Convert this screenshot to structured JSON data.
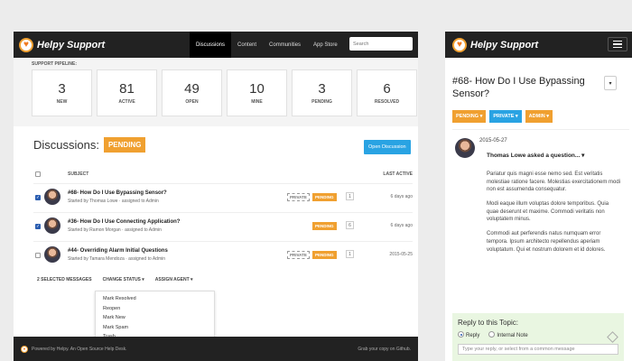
{
  "desktop": {
    "logo": "Helpy Support",
    "nav": [
      "Discussions",
      "Content",
      "Communities",
      "App Store"
    ],
    "search_placeholder": "Search",
    "pipeline_label": "SUPPORT PIPELINE:",
    "pipeline": [
      {
        "num": "3",
        "label": "NEW"
      },
      {
        "num": "81",
        "label": "ACTIVE"
      },
      {
        "num": "49",
        "label": "OPEN"
      },
      {
        "num": "10",
        "label": "MINE"
      },
      {
        "num": "3",
        "label": "PENDING"
      },
      {
        "num": "6",
        "label": "RESOLVED"
      }
    ],
    "disc_title": "Discussions:",
    "disc_badge": "PENDING",
    "open_btn": "Open Discussion",
    "col_subject": "SUBJECT",
    "col_last": "LAST ACTIVE",
    "rows": [
      {
        "title": "#68- How Do I Use Bypassing Sensor?",
        "sub": "Started by Thomas Lowe · assigned to Admin",
        "private": "PRIVATE",
        "pending": "PENDING",
        "count": "1",
        "ago": "6 days ago"
      },
      {
        "title": "#36- How Do I Use Connecting Application?",
        "sub": "Started by Ramon Morgan · assigned to Admin",
        "private": "",
        "pending": "PENDING",
        "count": "6",
        "ago": "6 days ago"
      },
      {
        "title": "#44- Overriding Alarm Initial Questions",
        "sub": "Started by Tamara Mendoza · assigned to Admin",
        "private": "PRIVATE",
        "pending": "PENDING",
        "count": "1",
        "ago": "2015-05-25"
      }
    ],
    "bulk": {
      "selected": "2 SELECTED MESSAGES",
      "change_status": "CHANGE STATUS ▾",
      "assign": "ASSIGN AGENT ▾"
    },
    "dropdown": [
      "Mark Resolved",
      "Reopen",
      "Mark New",
      "Mark Spam",
      "Trash"
    ],
    "footer_left": "Powered by Helpy. An Open Source Help Desk.",
    "footer_right": "Grab your copy on Github."
  },
  "mobile": {
    "logo": "Helpy Support",
    "title": "#68- How Do I Use Bypassing Sensor?",
    "tags": [
      "PENDING ▾",
      "PRIVATE ▾",
      "ADMIN ▾"
    ],
    "tag_colors": [
      "#f0a030",
      "#29a3e3",
      "#f0a030"
    ],
    "date": "2015-05-27",
    "author": "Thomas Lowe asked a question... ▾",
    "paragraphs": [
      "Pariatur quis magni esse nemo sed. Est veritatis molestiae ratione facere. Molestias exercitationem modi non est assumenda consequatur.",
      "Modi eaque illum voluptas dolore temporibus. Quia quae deserunt et maxime. Commodi veritatis non voluptatem minus.",
      "Commodi aut perferendis natus numquam error tempora. Ipsum architecto repellendus aperiam voluptatum. Qui et nostrum dolorem et id dolores."
    ],
    "reply_title": "Reply to this Topic:",
    "reply_option": "Reply",
    "internal_option": "Internal Note",
    "reply_placeholder": "Type your reply, or select from a common message"
  }
}
